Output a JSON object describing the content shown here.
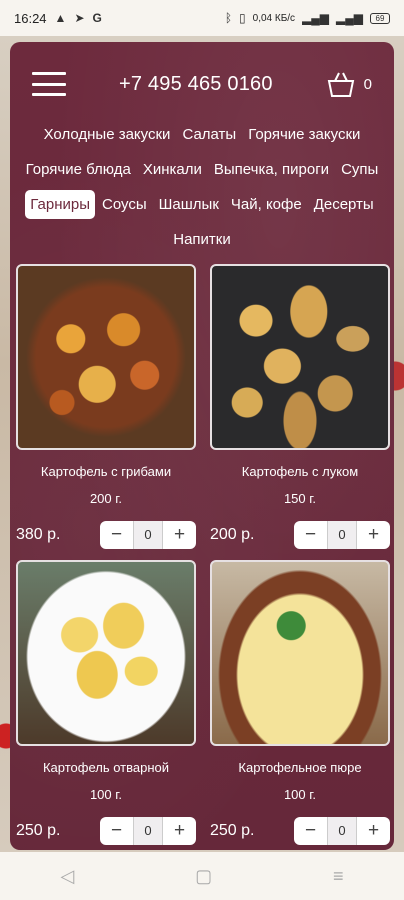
{
  "status_bar": {
    "time": "16:24",
    "right_text": "0,04 КБ/с",
    "battery": "69"
  },
  "header": {
    "phone": "+7 495 465 0160",
    "cart_count": "0"
  },
  "categories": [
    {
      "label": "Холодные закуски",
      "active": false
    },
    {
      "label": "Салаты",
      "active": false
    },
    {
      "label": "Горячие закуски",
      "active": false
    },
    {
      "label": "Горячие блюда",
      "active": false
    },
    {
      "label": "Хинкали",
      "active": false
    },
    {
      "label": "Выпечка, пироги",
      "active": false
    },
    {
      "label": "Супы",
      "active": false
    },
    {
      "label": "Гарниры",
      "active": true
    },
    {
      "label": "Соусы",
      "active": false
    },
    {
      "label": "Шашлык",
      "active": false
    },
    {
      "label": "Чай, кофе",
      "active": false
    },
    {
      "label": "Десерты",
      "active": false
    },
    {
      "label": "Напитки",
      "active": false
    }
  ],
  "products": [
    {
      "name": "Картофель с грибами",
      "weight": "200 г.",
      "price": "380 р.",
      "qty": "0"
    },
    {
      "name": "Картофель с луком",
      "weight": "150 г.",
      "price": "200 р.",
      "qty": "0"
    },
    {
      "name": "Картофель отварной",
      "weight": "100 г.",
      "price": "250 р.",
      "qty": "0"
    },
    {
      "name": "Картофельное пюре",
      "weight": "100 г.",
      "price": "250 р.",
      "qty": "0"
    }
  ],
  "stepper": {
    "minus": "−",
    "plus": "+"
  },
  "colors": {
    "panel": "#6d2a3d",
    "accent_text": "#ffffff"
  }
}
